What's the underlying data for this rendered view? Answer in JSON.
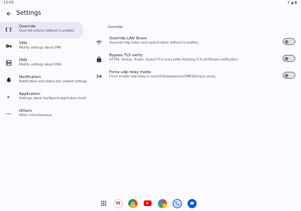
{
  "status_bar": {
    "time": "12:00",
    "icons": [
      "wifi-icon",
      "signal-icon",
      "battery-icon"
    ]
  },
  "topbar": {
    "title": "Settings"
  },
  "sidebar": {
    "items": [
      {
        "icon": "[ ]",
        "title": "Override",
        "subtitle": "Override entries defined in profiles",
        "selected": true
      },
      {
        "icon": "key",
        "title": "VPN",
        "subtitle": "Modify settings about VPN",
        "selected": false
      },
      {
        "icon": "dns",
        "title": "DNS",
        "subtitle": "Modify settings about DNS",
        "selected": false
      },
      {
        "icon": "bell",
        "title": "Notification",
        "subtitle": "Notification and status bar related settings",
        "selected": false
      },
      {
        "icon": "chevrons",
        "title": "Application",
        "subtitle": "Settings about Surfboard application itself",
        "selected": false
      },
      {
        "icon": "dots",
        "title": "Others",
        "subtitle": "Other miscellaneous",
        "selected": false
      }
    ]
  },
  "main": {
    "section_label": "Override",
    "settings": [
      {
        "icon": "wifi",
        "title": "Override LAN Share",
        "subtitle": "Override http-listen and socks5-listen defined in profiles",
        "enabled": false
      },
      {
        "icon": "lock",
        "title": "Bypass TLS verify",
        "subtitle": "HTTPS, Vmess, Trojan, Socks5-TLS and profile fetching TLS certificate verification",
        "enabled": false
      },
      {
        "icon": "relay",
        "title": "Force udp-relay mode",
        "subtitle": "Force enable udp-relay in socks5/shadowsocks/VMESS/trojan proxy",
        "enabled": false
      }
    ]
  },
  "dock": {
    "apps": [
      "app-drawer",
      "gmail",
      "chrome",
      "youtube",
      "photos",
      "phone",
      "messages"
    ]
  },
  "colors": {
    "background": "#fbfaff",
    "selected_item": "#e6e8f3",
    "toggle_off": "#e3e2ea",
    "toggle_outline": "#767680"
  }
}
